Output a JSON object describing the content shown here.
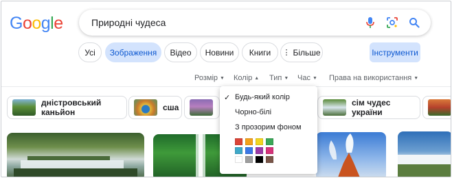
{
  "logo": {
    "letters": [
      "G",
      "o",
      "o",
      "g",
      "l",
      "e"
    ],
    "colors": [
      "#4285F4",
      "#EA4335",
      "#FBBC05",
      "#4285F4",
      "#34A853",
      "#EA4335"
    ]
  },
  "search": {
    "query": "Природні чудеса",
    "icons": [
      "mic-icon",
      "lens-icon",
      "search-icon"
    ]
  },
  "tabs": {
    "all": "Усі",
    "images": "Зображення",
    "video": "Відео",
    "news": "Новини",
    "books": "Книги",
    "more": "Більше",
    "active": "images"
  },
  "tools_label": "Інструменти",
  "filters": {
    "size": "Розмір",
    "color": "Колір",
    "type": "Тип",
    "time": "Час",
    "rights": "Права на використання"
  },
  "suggestions": [
    {
      "label": "дністровський каньйон"
    },
    {
      "label": "сша"
    },
    {
      "label": ""
    },
    {
      "label": "сім чудес україни"
    },
    {
      "label": ""
    }
  ],
  "color_menu": {
    "any_color": "Будь-який колір",
    "black_white": "Чорно-білі",
    "transparent": "З прозорим фоном",
    "selected": "any_color",
    "swatches": [
      "#db4437",
      "#f4a21b",
      "#f3d51f",
      "#3aa757",
      "#3fa9c9",
      "#3b78e7",
      "#9c3aa7",
      "#d6337a",
      "#ffffff",
      "#9e9e9e",
      "#000000",
      "#795548"
    ]
  },
  "colors": {
    "accent_bg": "#d3e3fd",
    "accent_text": "#0b57d0",
    "icon_blue": "#4285F4"
  }
}
